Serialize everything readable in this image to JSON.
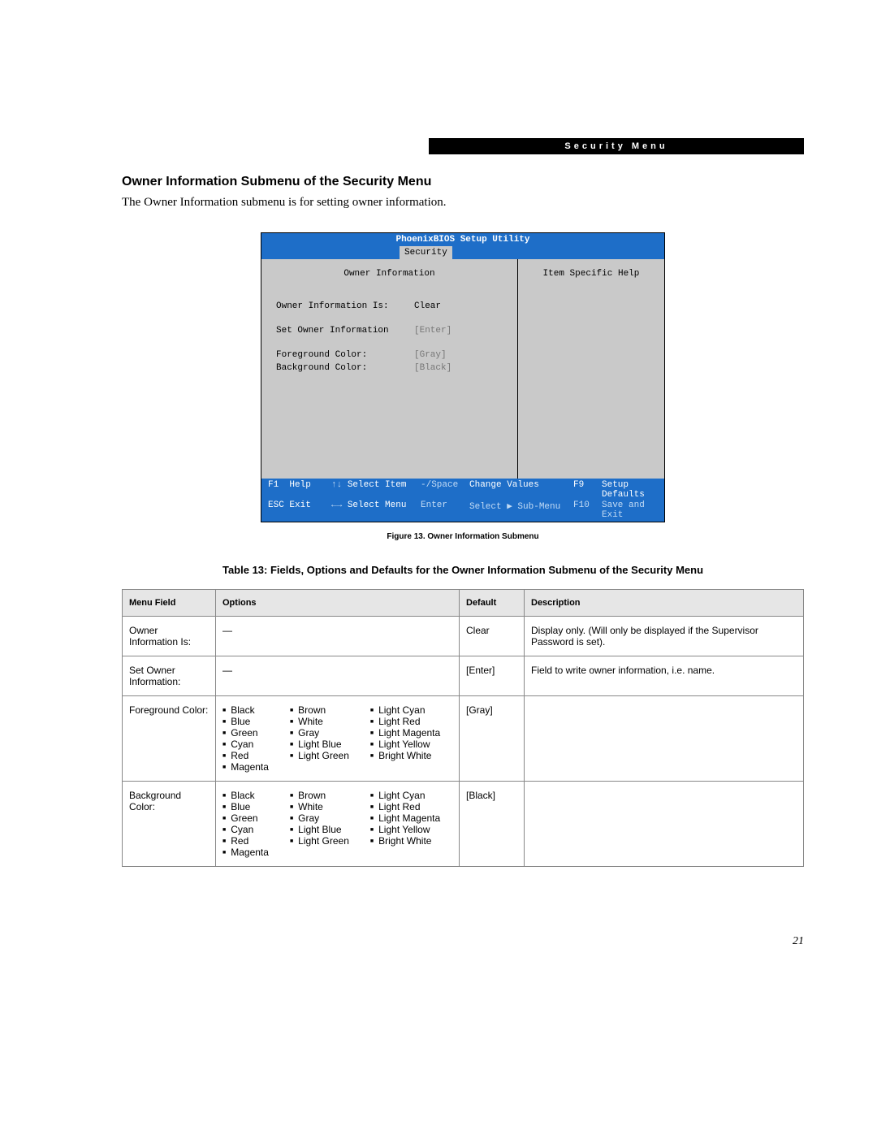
{
  "header": {
    "label": "Security Menu"
  },
  "section": {
    "title": "Owner Information Submenu of the Security Menu",
    "intro": "The Owner Information submenu is for setting owner information."
  },
  "bios": {
    "title": "PhoenixBIOS Setup Utility",
    "tab": "Security",
    "panel_title": "Owner Information",
    "help_title": "Item Specific Help",
    "rows": [
      {
        "label": "Owner Information Is:",
        "value": "Clear",
        "dim": false
      },
      {
        "label": "Set Owner Information",
        "value": "[Enter]",
        "dim": true
      },
      {
        "label": "Foreground Color:",
        "value": "[Gray]",
        "dim": true
      },
      {
        "label": "Background Color:",
        "value": "[Black]",
        "dim": true
      }
    ],
    "footer": {
      "r1c1k": "F1",
      "r1c1v": "Help",
      "r1c2k": "↑↓",
      "r1c2v": "Select Item",
      "r1c3k": "-/Space",
      "r1c3v": "Change Values",
      "r1c4k": "F9",
      "r1c4v": "Setup Defaults",
      "r2c1k": "ESC",
      "r2c1v": "Exit",
      "r2c2k": "←→",
      "r2c2v": "Select Menu",
      "r2c3k": "Enter",
      "r2c3v": "Select ▶ Sub-Menu",
      "r2c4k": "F10",
      "r2c4v": "Save and Exit"
    }
  },
  "figure_caption": "Figure 13.   Owner Information Submenu",
  "table_title": "Table 13: Fields, Options and Defaults for the Owner Information Submenu of the Security Menu",
  "table": {
    "headers": {
      "menu_field": "Menu Field",
      "options": "Options",
      "default": "Default",
      "description": "Description"
    },
    "rows": [
      {
        "menu_field": "Owner Information Is:",
        "options_dash": "—",
        "default": "Clear",
        "description": "Display only. (Will only be displayed if the Supervisor Password is set)."
      },
      {
        "menu_field": "Set Owner Information:",
        "options_dash": "—",
        "default": "[Enter]",
        "description": "Field to write owner information, i.e. name."
      },
      {
        "menu_field": "Foreground Color:",
        "default": "[Gray]",
        "description": "",
        "colors": {
          "col1": [
            "Black",
            "Blue",
            "Green",
            "Cyan",
            "Red",
            "Magenta"
          ],
          "col2": [
            "Brown",
            "White",
            "Gray",
            "Light Blue",
            "Light Green"
          ],
          "col3": [
            "Light Cyan",
            "Light Red",
            "Light Magenta",
            "Light Yellow",
            "Bright White"
          ]
        }
      },
      {
        "menu_field": "Background Color:",
        "default": "[Black]",
        "description": "",
        "colors": {
          "col1": [
            "Black",
            "Blue",
            "Green",
            "Cyan",
            "Red",
            "Magenta"
          ],
          "col2": [
            "Brown",
            "White",
            "Gray",
            "Light Blue",
            "Light Green"
          ],
          "col3": [
            "Light Cyan",
            "Light Red",
            "Light Magenta",
            "Light Yellow",
            "Bright White"
          ]
        }
      }
    ]
  },
  "page_number": "21"
}
